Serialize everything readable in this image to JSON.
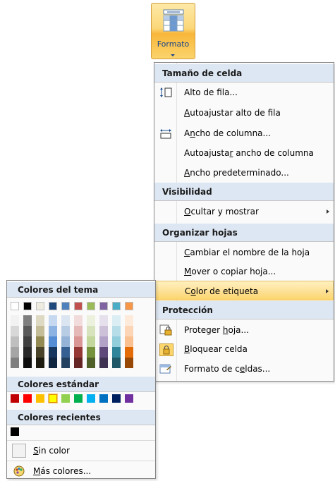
{
  "ribbon": {
    "formato_label": "Formato"
  },
  "menu": {
    "sections": {
      "tamano": "Tamaño de celda",
      "visibilidad": "Visibilidad",
      "organizar": "Organizar hojas",
      "proteccion": "Protección"
    },
    "items": {
      "alto_fila": "Alto de fila...",
      "autoajustar_alto": "Autoajustar alto de fila",
      "ancho_columna": "Ancho de columna...",
      "autoajustar_ancho": "Autoajustar ancho de columna",
      "ancho_predeterminado": "Ancho predeterminado...",
      "ocultar_mostrar": "Ocultar y mostrar",
      "cambiar_nombre": "Cambiar el nombre de la hoja",
      "mover_copiar": "Mover o copiar hoja...",
      "color_etiqueta": "Color de etiqueta",
      "proteger_hoja": "Proteger hoja...",
      "bloquear_celda": "Bloquear celda",
      "formato_celdas": "Formato de celdas..."
    }
  },
  "palette": {
    "theme_title": "Colores del tema",
    "standard_title": "Colores estándar",
    "recent_title": "Colores recientes",
    "no_color_label": "Sin color",
    "more_colors_label": "Más colores...",
    "theme_colors": [
      "#ffffff",
      "#000000",
      "#eeece1",
      "#1f497d",
      "#4f81bd",
      "#c0504d",
      "#9bbb59",
      "#8064a2",
      "#4bacc6",
      "#f79646"
    ],
    "theme_shades": [
      [
        "#f2f2f2",
        "#d8d8d8",
        "#bfbfbf",
        "#a5a5a5",
        "#7f7f7f"
      ],
      [
        "#7f7f7f",
        "#595959",
        "#3f3f3f",
        "#262626",
        "#0c0c0c"
      ],
      [
        "#ddd9c3",
        "#c4bd97",
        "#938953",
        "#494429",
        "#1d1b10"
      ],
      [
        "#c6d9f0",
        "#8db3e2",
        "#548dd4",
        "#17365d",
        "#0f243e"
      ],
      [
        "#dbe5f1",
        "#b8cce4",
        "#95b3d7",
        "#366092",
        "#244061"
      ],
      [
        "#f2dcdb",
        "#e5b9b7",
        "#d99694",
        "#953734",
        "#632423"
      ],
      [
        "#ebf1dd",
        "#d7e3bc",
        "#c3d69b",
        "#76923c",
        "#4f6128"
      ],
      [
        "#e5e0ec",
        "#ccc1d9",
        "#b2a2c7",
        "#5f497a",
        "#3f3151"
      ],
      [
        "#dbeef3",
        "#b7dde8",
        "#92cddc",
        "#31859b",
        "#205867"
      ],
      [
        "#fdeada",
        "#fbd5b5",
        "#fac08f",
        "#e36c09",
        "#974806"
      ]
    ],
    "standard_colors": [
      "#c00000",
      "#ff0000",
      "#ffc000",
      "#ffff00",
      "#92d050",
      "#00b050",
      "#00b0f0",
      "#0070c0",
      "#002060",
      "#7030a0"
    ],
    "recent_colors": [
      "#000000"
    ]
  }
}
